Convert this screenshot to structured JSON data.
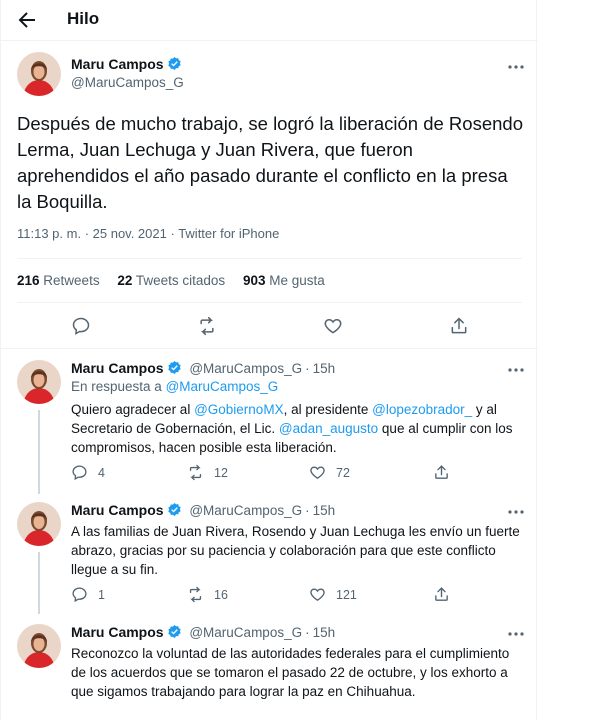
{
  "header": {
    "title": "Hilo"
  },
  "colors": {
    "accent": "#1d9bf0",
    "text": "#0f1419",
    "muted": "#536471",
    "border": "#eff3f4",
    "thread": "#cfd9de"
  },
  "main_tweet": {
    "name": "Maru Campos",
    "handle": "@MaruCampos_G",
    "text": "Después de mucho trabajo, se logró la liberación de Rosendo Lerma, Juan Lechuga y Juan Rivera, que fueron aprehendidos el año pasado durante el conflicto en la presa la Boquilla.",
    "time": "11:13 p. m.",
    "date": "25 nov. 2021",
    "source": "Twitter for iPhone",
    "sep": " · ",
    "retweets": "216",
    "retweets_label": "Retweets",
    "quotes": "22",
    "quotes_label": "Tweets citados",
    "likes": "903",
    "likes_label": "Me gusta"
  },
  "replies": [
    {
      "name": "Maru Campos",
      "handle": "@MaruCampos_G",
      "age": "15h",
      "reply_to_prefix": "En respuesta a ",
      "reply_to": "@MaruCampos_G",
      "text_parts": {
        "a": "Quiero agradecer al ",
        "b": "@GobiernoMX",
        "c": ", al presidente ",
        "d": "@lopezobrador_",
        "e": " y al Secretario de Gobernación, el Lic. ",
        "f": "@adan_augusto",
        "g": " que al cumplir con los compromisos, hacen posible esta liberación."
      },
      "replies": "4",
      "retweets": "12",
      "likes": "72"
    },
    {
      "name": "Maru Campos",
      "handle": "@MaruCampos_G",
      "age": "15h",
      "text": "A las familias de Juan Rivera, Rosendo y Juan Lechuga les envío un fuerte abrazo, gracias por su paciencia y colaboración para que este conflicto llegue a su fin.",
      "replies": "1",
      "retweets": "16",
      "likes": "121"
    },
    {
      "name": "Maru Campos",
      "handle": "@MaruCampos_G",
      "age": "15h",
      "text": "Reconozco la voluntad de las autoridades federales para el cumplimiento de los acuerdos que se tomaron el pasado 22 de octubre, y los exhorto a que sigamos trabajando para lograr la paz en Chihuahua."
    }
  ]
}
